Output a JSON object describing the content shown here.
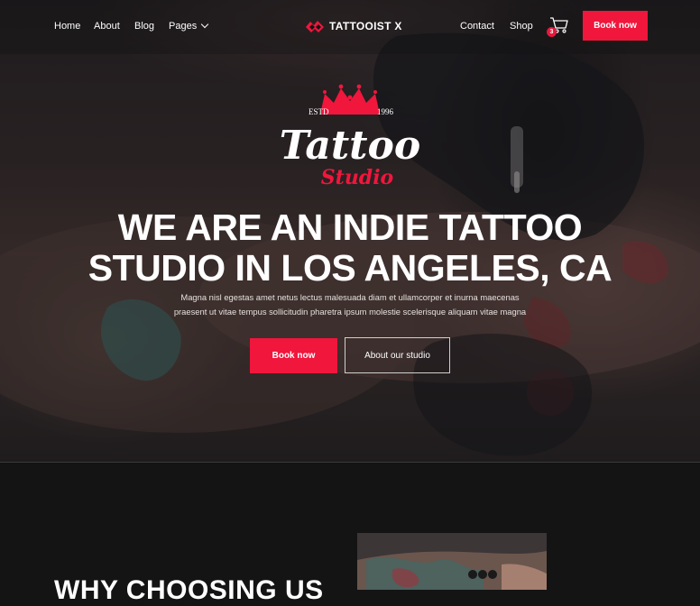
{
  "nav": {
    "links": [
      {
        "label": "Home"
      },
      {
        "label": "About"
      },
      {
        "label": "Blog"
      },
      {
        "label": "Pages"
      }
    ],
    "brand": "TATTOOIST X",
    "right_links": [
      {
        "label": "Contact"
      },
      {
        "label": "Shop"
      }
    ],
    "cart_count": "3",
    "book_button": "Book now"
  },
  "logo": {
    "estd": "ESTD",
    "year": "1996",
    "script": "Tattoo",
    "studio": "Studio"
  },
  "hero": {
    "title_lines": [
      "WE ARE AN INDIE TATTOO",
      "STUDIO IN LOS ANGELES, CA"
    ],
    "subtitle_lines": [
      "Magna nisl egestas amet netus lectus malesuada diam et ullamcorper et inurna maecenas",
      "praesent ut vitae tempus sollicitudin pharetra ipsum molestie scelerisque aliquam vitae magna"
    ],
    "primary_button": "Book now",
    "secondary_button": "About our studio"
  },
  "section2": {
    "title": "WHY CHOOSING US"
  },
  "colors": {
    "accent": "#f0163c",
    "background": "#141414",
    "text": "#ffffff"
  },
  "icons": {
    "cart": "shopping-cart-icon",
    "dropdown": "chevron-down-icon",
    "brand": "tattoo-machine-logo-icon",
    "crown": "crown-icon"
  }
}
